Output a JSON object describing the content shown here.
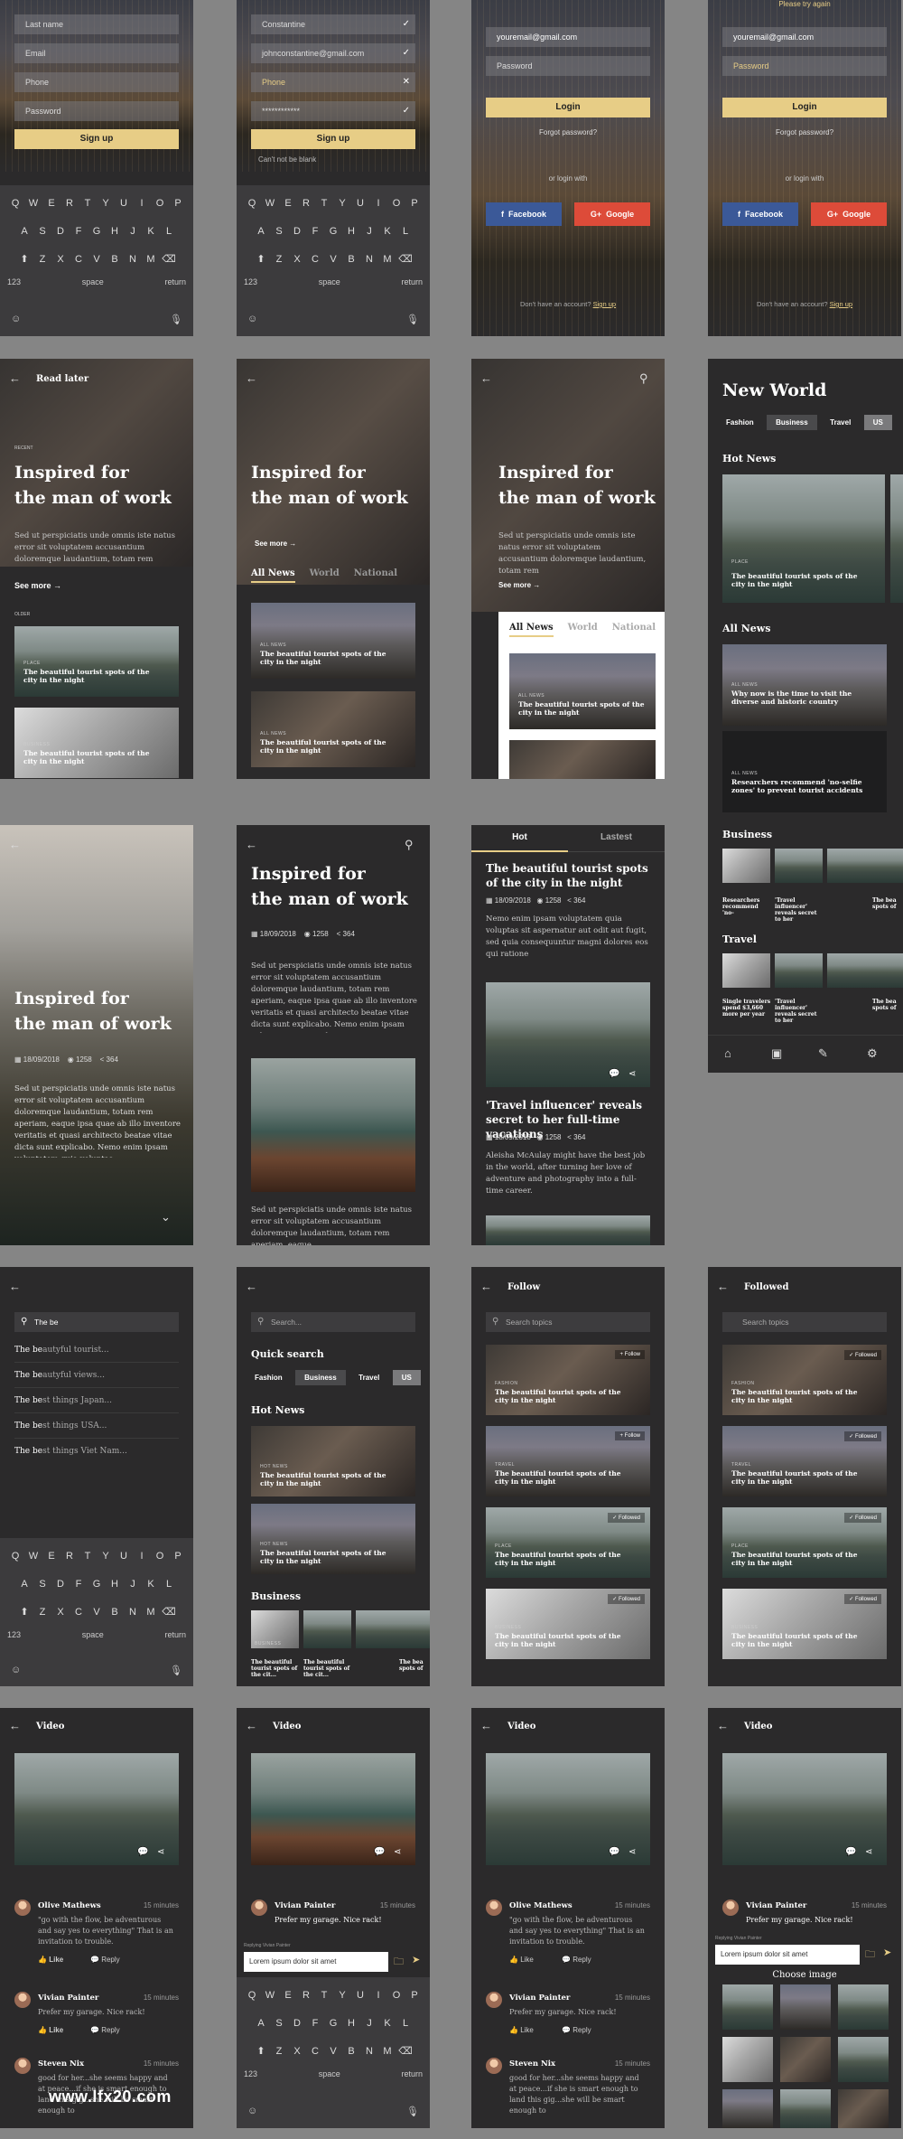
{
  "signup": {
    "fields": [
      "Last name",
      "Email",
      "Phone",
      "Password"
    ],
    "button": "Sign up",
    "filled": [
      "Constantine",
      "johnconstantine@gmail.com",
      "Phone",
      "************"
    ],
    "error": "Can't not be blank"
  },
  "keyboard": {
    "row1": [
      "Q",
      "W",
      "E",
      "R",
      "T",
      "Y",
      "U",
      "I",
      "O",
      "P"
    ],
    "row2": [
      "A",
      "S",
      "D",
      "F",
      "G",
      "H",
      "J",
      "K",
      "L"
    ],
    "row3": [
      "Z",
      "X",
      "C",
      "V",
      "B",
      "N",
      "M"
    ],
    "num": "123",
    "space": "space",
    "return": "return"
  },
  "login": {
    "email": "youremail@gmail.com",
    "password": "Password",
    "button": "Login",
    "forgot": "Forgot password?",
    "or": "or login with",
    "facebook": "Facebook",
    "google": "Google",
    "noaccount": "Don't have an account?",
    "signup": "Sign up",
    "tryagain": "Please try again"
  },
  "article": {
    "readlater": "Read later",
    "recent": "RECENT",
    "older": "OLDER",
    "title1": "Inspired for",
    "title2": "the man of work",
    "excerpt": "Sed ut perspiciatis unde omnis iste natus error sit voluptatem accusantium doloremque laudantium, totam rem",
    "seemore": "See more",
    "date": "18/09/2018",
    "views": "1258",
    "shares": "364",
    "long": "Sed ut perspiciatis unde omnis iste natus error sit voluptatem accusantium doloremque laudantium, totam rem aperiam, eaque ipsa quae ab illo inventore veritatis et quasi architecto beatae vitae dicta sunt explicabo. Nemo enim ipsam voluptatem quia voluptas",
    "long2": "Sed ut perspiciatis unde omnis iste natus error sit voluptatem accusantium doloremque laudantium, totam rem aperiam, eaque"
  },
  "tabs": [
    "All News",
    "World",
    "National"
  ],
  "card": {
    "place": "PLACE",
    "allnews": "ALL NEWS",
    "business": "BUSINESS",
    "fashion": "FASHION",
    "travel": "TRAVEL",
    "hotnews": "HOT NEWS",
    "beautiful": "The beautiful tourist spots of the city in the night"
  },
  "hot": {
    "tab1": "Hot",
    "tab2": "Lastest",
    "h1": "The beautiful tourist spots of the city in the night",
    "p1": "Nemo enim ipsam voluptatem quia voluptas sit aspernatur aut odit aut fugit, sed quia consequuntur magni dolores eos qui ratione",
    "h2": "'Travel influencer' reveals secret to her full-time vacations",
    "p2": "Aleisha McAulay might have the best job in the world, after turning her love of adventure and photography into a full-time career."
  },
  "world": {
    "title": "New World",
    "pills": [
      "Fashion",
      "Business",
      "Travel",
      "US"
    ],
    "hotnews": "Hot News",
    "allnews": "All News",
    "a1": "Why now is the time to visit the diverse and historic country",
    "a2": "Researchers recommend 'no-selfie zones' to prevent tourist accidents",
    "business": "Business",
    "travel": "Travel",
    "b1": "Researchers recommend 'no-",
    "b2": "'Travel influencer' reveals secret to her",
    "b3": "The bea spots of",
    "t1": "Single travelers spend $3,660 more per year",
    "t2": "'Travel influencer' reveals secret to her",
    "t3": "The bea spots of"
  },
  "search": {
    "query": "The be",
    "prefix": "The be",
    "suggestions": [
      "autyful tourist...",
      "autyful views...",
      "st things Japan...",
      "st things USA...",
      "st things Viet Nam..."
    ],
    "placeholder": "Search...",
    "quick": "Quick search",
    "hotnews": "Hot News",
    "business": "Business",
    "bcap": "The beautiful tourist spots of the cit...",
    "bcap3": "The bea spots of"
  },
  "follow": {
    "title": "Follow",
    "title2": "Followed",
    "placeholder": "Search topics",
    "follow": "+ Follow",
    "followed": "✓ Followed"
  },
  "video": {
    "title": "Video",
    "c1name": "Olive Mathews",
    "c1time": "15 minutes",
    "c1text": "\"go with the flow, be adventurous and say yes to everything\" That is an invitation to trouble.",
    "c2name": "Vivian Painter",
    "c2time": "15 minutes",
    "c2text": "Prefer my garage. Nice rack!",
    "c3name": "Steven Nix",
    "c3time": "15 minutes",
    "c3text": "good for her...she seems happy and at peace...if she is smart enough to land this gig...she will be smart enough to",
    "like": "Like",
    "reply": "Reply",
    "replying": "Replying Vivian Painter",
    "input": "Lorem ipsum dolor sit  amet",
    "choose": "Choose image"
  },
  "watermark": "www.lfx20.com"
}
